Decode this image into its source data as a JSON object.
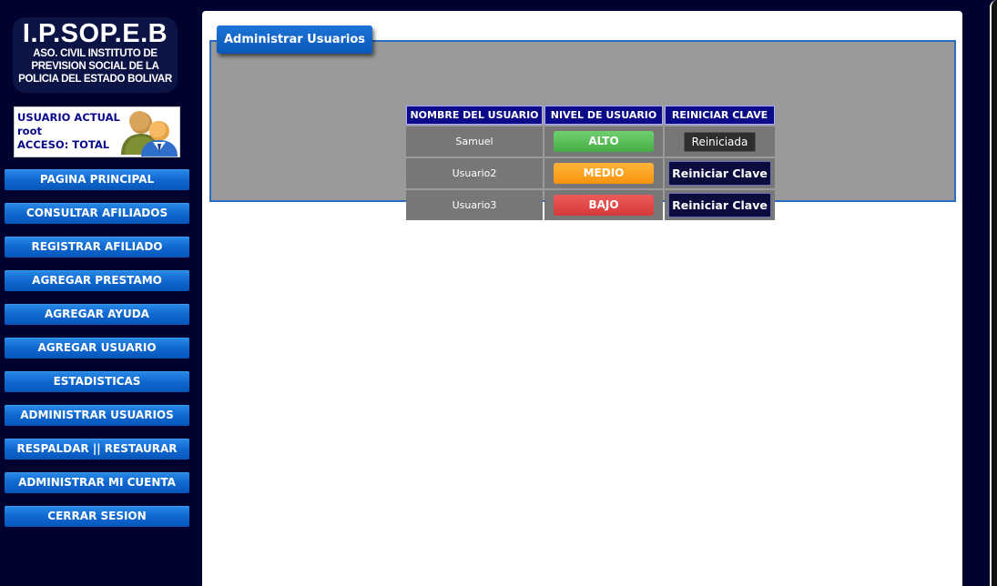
{
  "logo": {
    "title": "I.P.SOP.E.B",
    "line1": "ASO. CIVIL INSTITUTO DE",
    "line2": "PREVISION SOCIAL DE LA",
    "line3": "POLICIA DEL ESTADO BOLIVAR"
  },
  "user_box": {
    "label": "USUARIO ACTUAL",
    "username": "root",
    "access": "ACCESO: TOTAL",
    "icon": "users-group-icon"
  },
  "nav": {
    "items": [
      "PAGINA PRINCIPAL",
      "CONSULTAR AFILIADOS",
      "REGISTRAR AFILIADO",
      "AGREGAR PRESTAMO",
      "AGREGAR AYUDA",
      "AGREGAR USUARIO",
      "ESTADISTICAS",
      "ADMINISTRAR USUARIOS",
      "RESPALDAR || RESTAURAR",
      "ADMINISTRAR MI CUENTA",
      "CERRAR SESION"
    ]
  },
  "panel": {
    "legend": "Administrar Usuarios"
  },
  "table": {
    "headers": [
      "NOMBRE DEL USUARIO",
      "NIVEL DE USUARIO",
      "REINICIAR CLAVE"
    ],
    "rows": [
      {
        "name": "Samuel",
        "level": "ALTO",
        "reset": "Reiniciada"
      },
      {
        "name": "Usuario2",
        "level": "MEDIO",
        "reset": "Reiniciar Clave"
      },
      {
        "name": "Usuario3",
        "level": "BAJO",
        "reset": "Reiniciar Clave"
      }
    ]
  },
  "colors": {
    "background": "#02022e",
    "nav_button": "#1068cf",
    "level_alto": "#45ad45",
    "level_medio": "#f7940e",
    "level_bajo": "#d63a3a",
    "header": "#0b0b8a"
  }
}
